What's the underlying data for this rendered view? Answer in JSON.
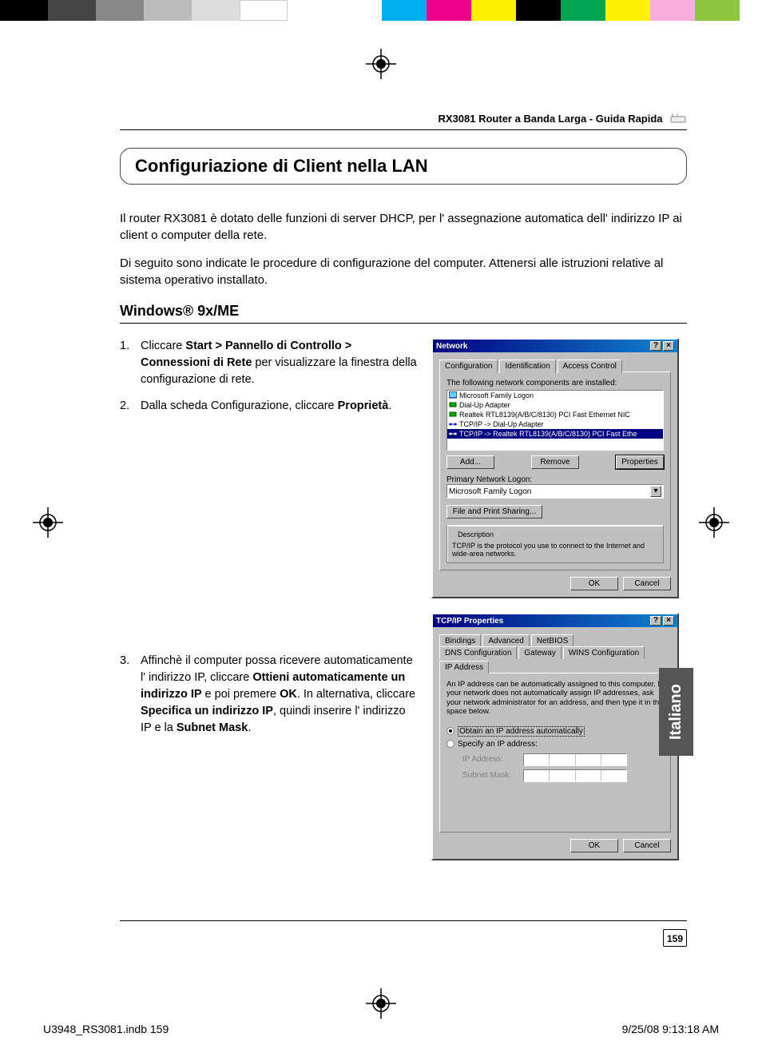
{
  "header": {
    "title": "RX3081 Router a Banda Larga - Guida Rapida"
  },
  "section_heading": "Configuriazione di Client nella LAN",
  "intro_p1": "Il router RX3081 è dotato delle funzioni di server DHCP, per l' assegnazione automatica dell' indirizzo IP ai client o computer della rete.",
  "intro_p2": "Di seguito sono indicate le procedure di configurazione del computer. Attenersi alle istruzioni relative al sistema operativo installato.",
  "sub_heading": "Windows® 9x/ME",
  "steps": {
    "s1": {
      "num": "1.",
      "pre": "Cliccare ",
      "bold1": "Start > Pannello di Controllo > Connessioni di Rete",
      "post1": " per visualizzare la finestra della configurazione di rete."
    },
    "s2": {
      "num": "2.",
      "pre": "Dalla scheda Configurazione, cliccare ",
      "bold1": "Proprietà",
      "post1": "."
    },
    "s3": {
      "num": "3.",
      "pre": "Affinchè il computer possa ricevere automaticamente l' indirizzo IP, cliccare ",
      "bold1": "Ottieni automaticamente un indirizzo IP",
      "mid1": " e poi premere ",
      "bold2": "OK",
      "mid2": ". In alternativa, cliccare ",
      "bold3": "Specifica un indirizzo IP",
      "mid3": ", quindi inserire l' indirizzo IP e la ",
      "bold4": "Subnet Mask",
      "post": "."
    }
  },
  "dialog1": {
    "title": "Network",
    "tabs": {
      "t1": "Configuration",
      "t2": "Identification",
      "t3": "Access Control"
    },
    "label_components": "The following network components are installed:",
    "items": {
      "i1": "Microsoft Family Logon",
      "i2": "Dial-Up Adapter",
      "i3": "Realtek RTL8139(A/B/C/8130) PCI Fast Ethernet NIC",
      "i4": "TCP/IP -> Dial-Up Adapter",
      "i5": "TCP/IP -> Realtek RTL8139(A/B/C/8130) PCI Fast Ethe"
    },
    "btn_add": "Add...",
    "btn_remove": "Remove",
    "btn_properties": "Properties",
    "primary_logon_label": "Primary Network Logon:",
    "primary_logon_value": "Microsoft Family Logon",
    "btn_file_print": "File and Print Sharing...",
    "desc_label": "Description",
    "desc_text": "TCP/IP is the protocol you use to connect to the Internet and wide-area networks.",
    "btn_ok": "OK",
    "btn_cancel": "Cancel"
  },
  "dialog2": {
    "title": "TCP/IP Properties",
    "tabs_row1": {
      "t1": "Bindings",
      "t2": "Advanced",
      "t3": "NetBIOS"
    },
    "tabs_row2": {
      "t1": "DNS Configuration",
      "t2": "Gateway",
      "t3": "WINS Configuration",
      "t4": "IP Address"
    },
    "desc": "An IP address can be automatically assigned to this computer. If your network does not automatically assign IP addresses, ask your network administrator for an address, and then type it in the space below.",
    "radio_auto": "Obtain an IP address automatically",
    "radio_specify": "Specify an IP address:",
    "ip_label": "IP Address:",
    "subnet_label": "Subnet Mask:",
    "btn_ok": "OK",
    "btn_cancel": "Cancel"
  },
  "side_tab": "Italiano",
  "page_number": "159",
  "print_footer": {
    "left": "U3948_RS3081.indb   159",
    "right": "9/25/08   9:13:18 AM"
  }
}
